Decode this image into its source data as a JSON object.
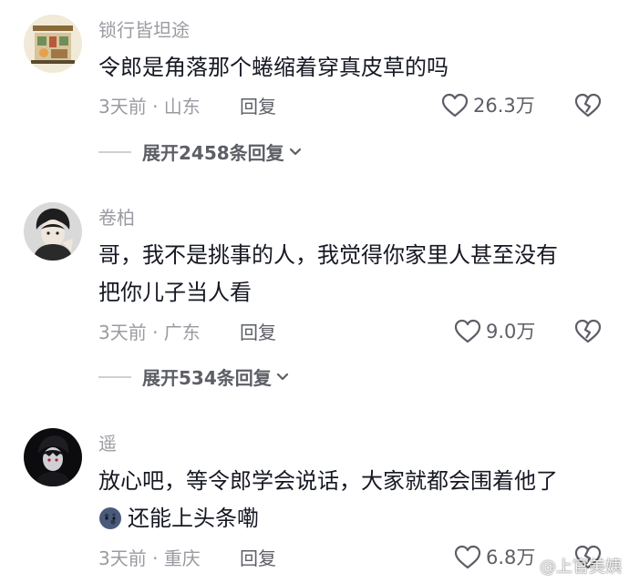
{
  "comments": [
    {
      "username": "锁行皆坦途",
      "lines": [
        "令郎是角落那个蜷缩着穿真皮草的吗"
      ],
      "time_location": "3天前 · 山东",
      "reply_label": "回复",
      "likes": "26.3万",
      "expand_label": "展开2458条回复",
      "avatar_icon": "cartoon-shop-avatar-icon"
    },
    {
      "username": "卷柏",
      "lines": [
        "哥，我不是挑事的人，我觉得你家里人甚至没有",
        "把你儿子当人看"
      ],
      "time_location": "3天前 · 广东",
      "reply_label": "回复",
      "likes": "9.0万",
      "expand_label": "展开534条回复",
      "avatar_icon": "anime-man-avatar-icon"
    },
    {
      "username": "遥",
      "lines": [
        "放心吧，等令郎学会说话，大家就都会围着他了",
        "还能上头条嘞"
      ],
      "time_location": "3天前 · 重庆",
      "reply_label": "回复",
      "likes": "6.8万",
      "avatar_icon": "dark-anime-avatar-icon",
      "emoji_icon": "moon-face-emoji-icon"
    }
  ],
  "watermark": "@上官美姨",
  "colors": {
    "primary_text": "#161823",
    "secondary_text": "#9a9ba1",
    "action_text": "#5d5e66"
  }
}
